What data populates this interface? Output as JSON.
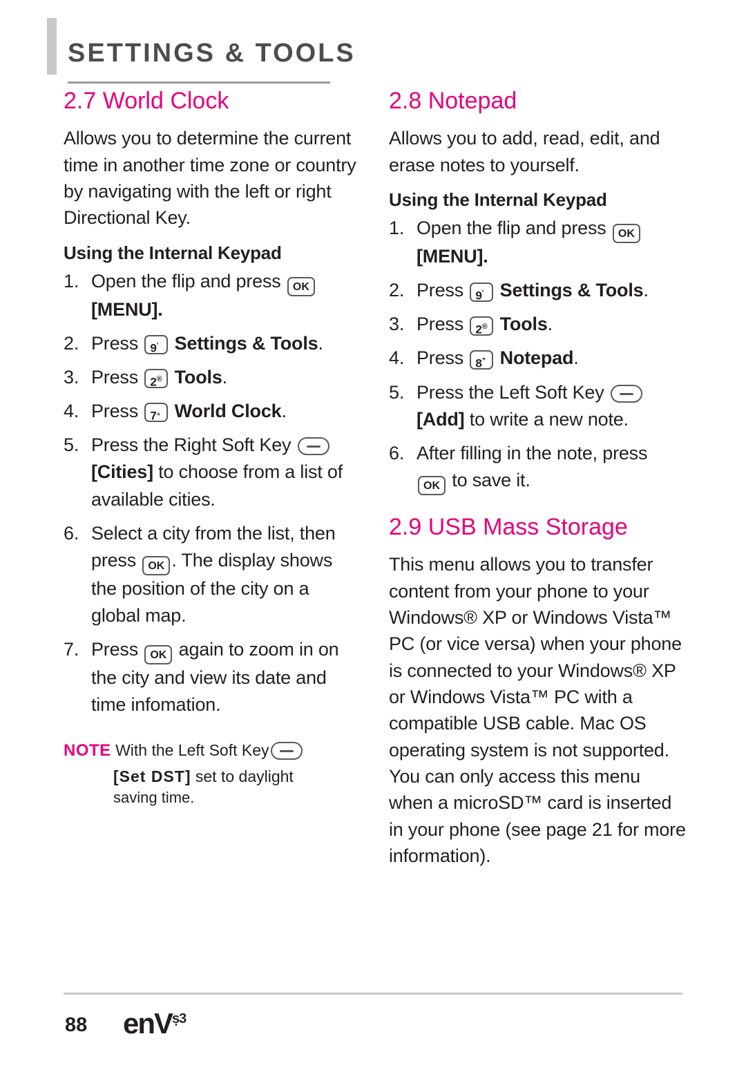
{
  "header": {
    "title": "SETTINGS & TOOLS"
  },
  "left_column": {
    "section_number_title": "2.7 World Clock",
    "intro": "Allows you to determine the current time in another time zone or country by navigating with the left or right Directional Key.",
    "subheading": "Using the Internal Keypad",
    "steps": [
      {
        "num": "1.",
        "pre": "Open the flip and press ",
        "key": "OK",
        "post": "",
        "bold_after": "[MENU]."
      },
      {
        "num": "2.",
        "pre": "Press ",
        "key": "9",
        "key_sup": "‘",
        "bold_after": "Settings & Tools",
        "tail": "."
      },
      {
        "num": "3.",
        "pre": "Press ",
        "key": "2",
        "key_sup": "®",
        "bold_after": "Tools",
        "tail": "."
      },
      {
        "num": "4.",
        "pre": "Press ",
        "key": "7",
        "key_sup": "₄",
        "bold_after": "World Clock",
        "tail": "."
      },
      {
        "num": "5.",
        "pre": "Press the Right Soft Key ",
        "softkey": true,
        "bold_after": "[Cities]",
        "tail": " to choose from a list of available cities."
      },
      {
        "num": "6.",
        "pre": "Select a city from the list, then press ",
        "key": "OK",
        "tail": ". The display shows the position of the city on a global map."
      },
      {
        "num": "7.",
        "pre": "Press ",
        "key": "OK",
        "tail": " again to zoom in on the city and view its date and time infomation."
      }
    ],
    "note": {
      "label": "NOTE",
      "line1": "With the Left Soft Key",
      "line2_bold": "[Set DST]",
      "line2_rest": " set to daylight",
      "line3": "saving time."
    }
  },
  "right_column": {
    "notepad": {
      "section_number_title": "2.8 Notepad",
      "intro": "Allows you to add, read, edit, and erase notes to yourself.",
      "subheading": "Using the Internal Keypad",
      "steps": [
        {
          "num": "1.",
          "pre": "Open the flip and press ",
          "key": "OK",
          "bold_after": "[MENU]."
        },
        {
          "num": "2.",
          "pre": "Press ",
          "key": "9",
          "key_sup": "‘",
          "bold_after": "Settings & Tools",
          "tail": "."
        },
        {
          "num": "3.",
          "pre": "Press ",
          "key": "2",
          "key_sup": "®",
          "bold_after": "Tools",
          "tail": "."
        },
        {
          "num": "4.",
          "pre": "Press ",
          "key": "8",
          "key_sup": "⁺",
          "bold_after": "Notepad",
          "tail": "."
        },
        {
          "num": "5.",
          "pre": "Press the Left Soft Key ",
          "softkey": true,
          "bold_after": "[Add]",
          "tail": " to write a new note."
        },
        {
          "num": "6.",
          "pre": "After filling in the note, press ",
          "key": "OK",
          "tail": " to save it."
        }
      ]
    },
    "usb": {
      "section_number_title": "2.9 USB Mass Storage",
      "body": "This menu allows you to transfer content from your phone to your Windows® XP or Windows Vista™ PC (or vice versa) when your phone is connected to your Windows® XP or Windows Vista™ PC with a compatible USB cable. Mac OS operating system is not supported. You can only access this menu when a microSD™ card is inserted in your phone (see page 21 for more information)."
    }
  },
  "footer": {
    "page_number": "88",
    "logo_text": "enV",
    "logo_sup": "ș3"
  },
  "colors": {
    "accent": "#e6007e",
    "text": "#231f20",
    "header_gray": "#4d4d4d",
    "rule_gray": "#c8c8c8"
  }
}
